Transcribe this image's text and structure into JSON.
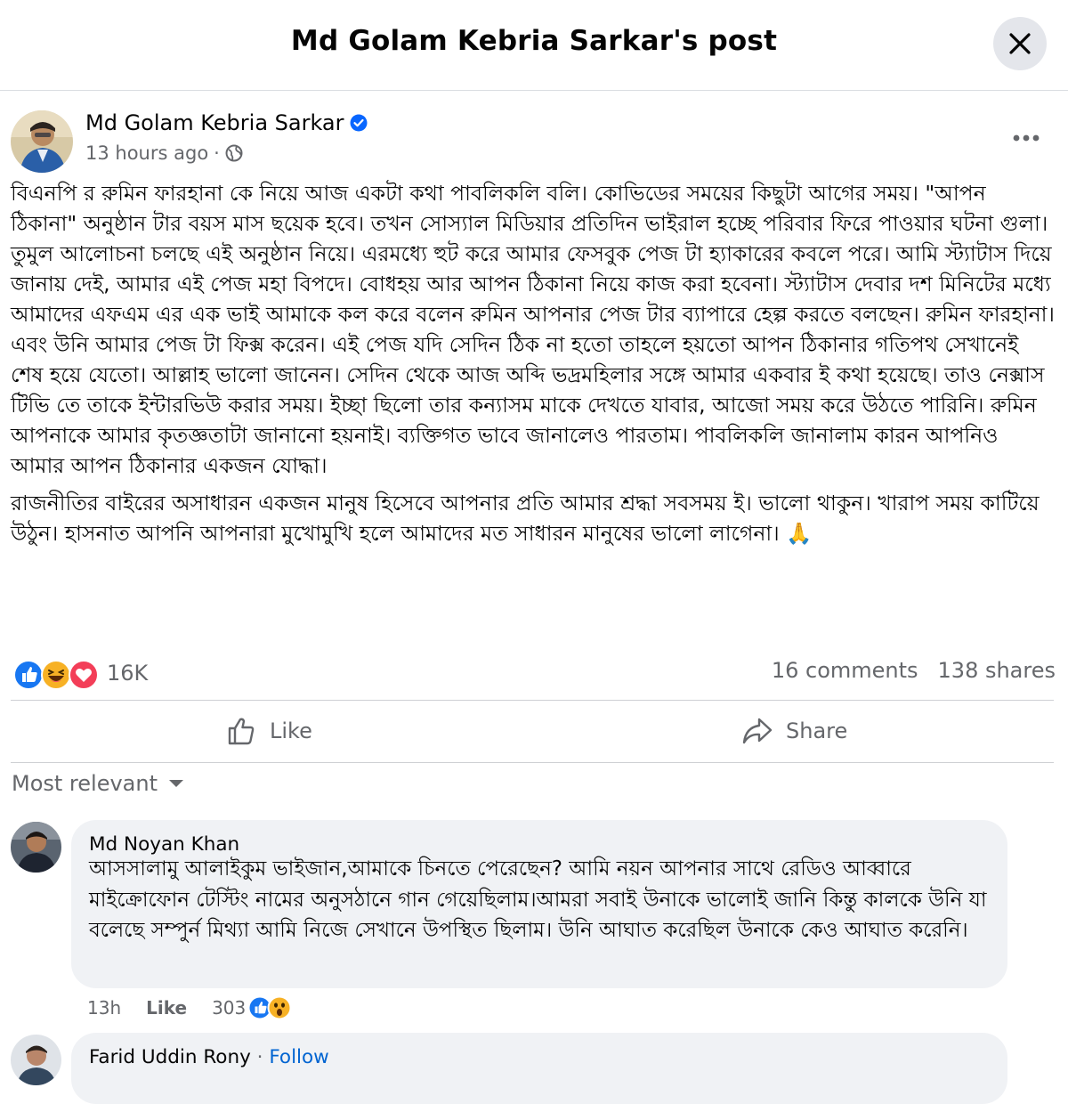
{
  "header": {
    "title": "Md Golam Kebria Sarkar's post"
  },
  "post": {
    "author": "Md Golam Kebria Sarkar",
    "time": "13 hours ago",
    "separator": "·",
    "paragraphs": [
      "বিএনপি র রুমিন ফারহানা কে নিয়ে আজ একটা কথা পাবলিকলি বলি। কোভিডের সময়ের কিছুটা আগের সময়। \"আপন ঠিকানা\" অনুষ্ঠান টার বয়স মাস ছয়েক হবে। তখন সোস্যাল মিডিয়ার প্রতিদিন ভাইরাল হচ্ছে পরিবার ফিরে পাওয়ার ঘটনা গুলা। তুমুল আলোচনা চলছে এই অনুষ্ঠান নিয়ে।  এরমধ্যে হুট করে আমার ফেসবুক পেজ টা হ্যাকারের কবলে পরে। আমি স্ট্যাটাস দিয়ে জানায় দেই, আমার এই পেজ মহা বিপদে। বোধহয় আর আপন ঠিকানা নিয়ে কাজ করা হবেনা। স্ট্যাটাস দেবার দশ মিনিটের মধ্যে আমাদের এফএম এর এক ভাই আমাকে কল করে বলেন রুমিন আপনার পেজ টার ব্যাপারে হেল্প করতে বলছেন। রুমিন ফারহানা। এবং উনি আমার পেজ টা ফিক্স করেন। এই পেজ যদি সেদিন ঠিক না হতো তাহলে হয়তো আপন ঠিকানার গতিপথ সেখানেই শেষ হয়ে যেতো। আল্লাহ ভালো জানেন। সেদিন থেকে আজ অব্দি ভদ্রমহিলার সঙ্গে আমার একবার ই কথা হয়েছে। তাও নেক্সাস টিভি তে তাকে ইন্টারভিউ করার সময়। ইচ্ছা ছিলো তার কন্যাসম মাকে দেখতে যাবার, আজো সময় করে উঠতে পারিনি। রুমিন আপনাকে আমার কৃতজ্ঞতাটা জানানো হয়নাই। ব্যক্তিগত ভাবে জানালেও পারতাম। পাবলিকলি জানালাম কারন আপনিও আমার আপন ঠিকানার একজন যোদ্ধা।",
      "রাজনীতির বাইরের অসাধারন একজন মানুষ হিসেবে আপনার প্রতি আমার শ্রদ্ধা সবসময় ই।  ভালো থাকুন। খারাপ সময় কাটিয়ে উঠুন। হাসনাত আপনি আপনারা মুখোমুখি হলে আমাদের মত সাধারন মানুষের ভালো লাগেনা। 🙏"
    ],
    "reaction_count": "16K",
    "comments_count": "16 comments",
    "shares_count": "138 shares",
    "like_label": "Like",
    "share_label": "Share"
  },
  "sort": {
    "label": "Most relevant"
  },
  "comments": [
    {
      "name": "Md Noyan Khan",
      "text": "আসসালামু আলাইকুম ভাইজান,আমাকে চিনতে পেরেছেন? আমি নয়ন আপনার সাথে রেডিও আব্বারে মাইক্রোফোন টেস্টিং নামের অনুসঠানে গান গেয়েছিলাম।আমরা সবাই উনাকে ভালোই জানি কিন্তু কালকে উনি যা বলেছে সম্পুর্ন মিথ্যা আমি নিজে সেখানে উপস্থিত ছিলাম। উনি আঘাত করেছিল উনাকে কেও আঘাত করেনি।",
      "time": "13h",
      "like": "Like",
      "reactions": "303"
    },
    {
      "name": "Farid Uddin Rony",
      "sep": " · ",
      "follow": "Follow"
    }
  ],
  "colors": {
    "accent": "#0866ff",
    "follow": "#0064d1",
    "muted": "#65676b",
    "bubble": "#f0f2f5"
  }
}
